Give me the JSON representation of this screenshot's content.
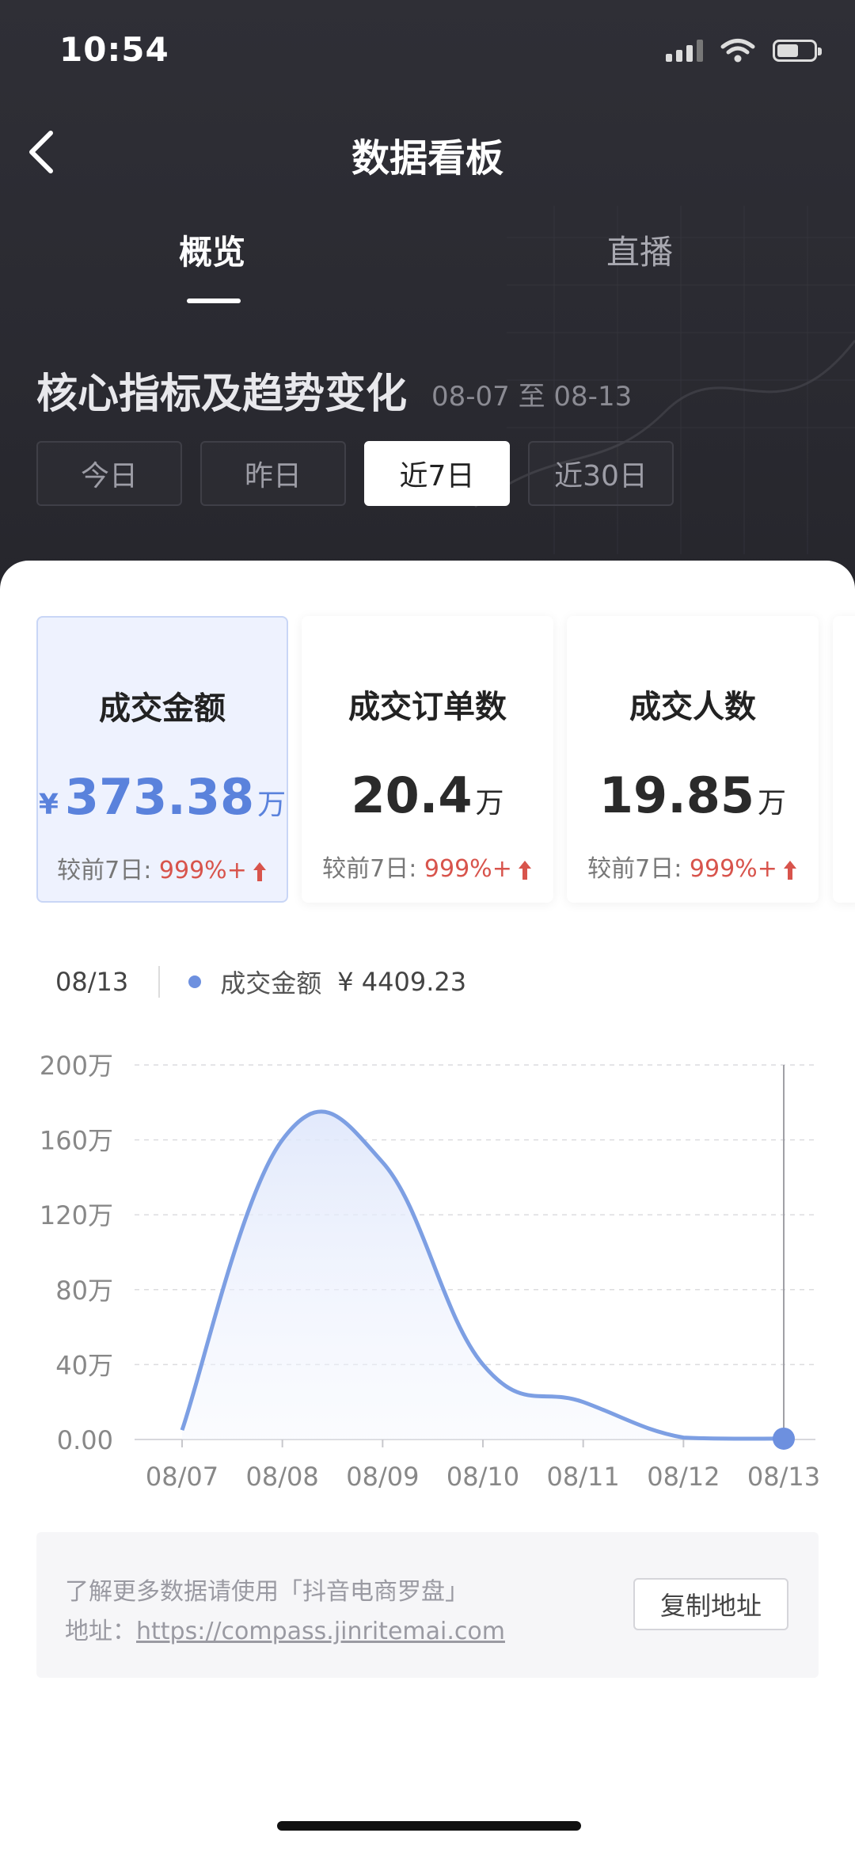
{
  "status_bar": {
    "time": "10:54"
  },
  "nav": {
    "title": "数据看板"
  },
  "tabs": [
    {
      "label": "概览",
      "active": true
    },
    {
      "label": "直播",
      "active": false
    }
  ],
  "section": {
    "title": "核心指标及趋势变化",
    "date_range": "08-07 至 08-13"
  },
  "range_buttons": [
    {
      "label": "今日",
      "active": false
    },
    {
      "label": "昨日",
      "active": false
    },
    {
      "label": "近7日",
      "active": true
    },
    {
      "label": "近30日",
      "active": false
    }
  ],
  "metrics": [
    {
      "label": "成交金额",
      "currency": "¥",
      "value": "373.38",
      "unit": "万",
      "compare_label": "较前7日:",
      "compare_value": "999%+",
      "selected": true
    },
    {
      "label": "成交订单数",
      "currency": "",
      "value": "20.4",
      "unit": "万",
      "compare_label": "较前7日:",
      "compare_value": "999%+",
      "selected": false
    },
    {
      "label": "成交人数",
      "currency": "",
      "value": "19.85",
      "unit": "万",
      "compare_label": "较前7日:",
      "compare_value": "999%+",
      "selected": false
    }
  ],
  "chart_legend": {
    "date": "08/13",
    "series_name": "成交金额",
    "value": "¥ 4409.23"
  },
  "chart_data": {
    "type": "area",
    "x": [
      "08/07",
      "08/08",
      "08/09",
      "08/10",
      "08/11",
      "08/12",
      "08/13"
    ],
    "series": [
      {
        "name": "成交金额",
        "values": [
          5,
          160,
          148,
          40,
          20,
          1,
          0.44
        ]
      }
    ],
    "y_ticks": [
      "0.00",
      "40万",
      "80万",
      "120万",
      "160万",
      "200万"
    ],
    "ylim": [
      0,
      200
    ],
    "grid": true,
    "highlight_x": "08/13",
    "colors": {
      "line": "#7d9fe3",
      "point": "#6d90df"
    }
  },
  "info": {
    "line1": "了解更多数据请使用「抖音电商罗盘」",
    "address_label": "地址：",
    "url": "https://compass.jinritemai.com",
    "copy_label": "复制地址"
  },
  "colors": {
    "accent": "#5a82dc",
    "up": "#d8544c",
    "header_bg": "#2d2d34"
  }
}
